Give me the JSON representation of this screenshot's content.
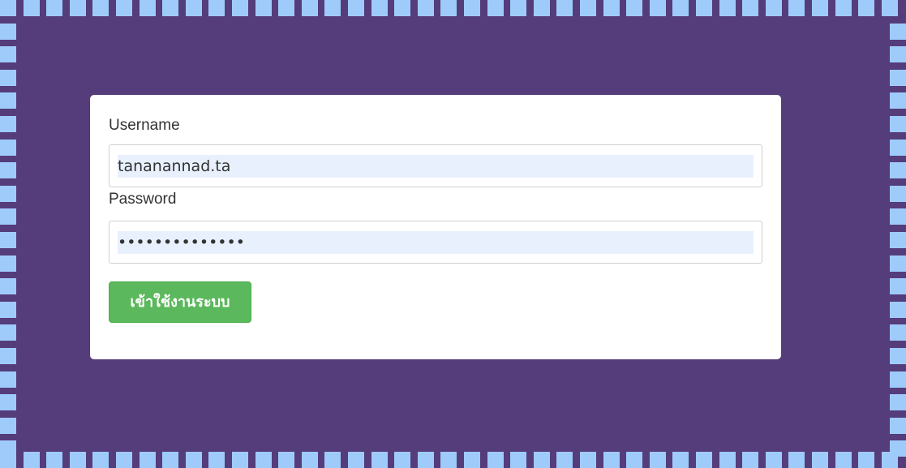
{
  "form": {
    "username_label": "Username",
    "username_value": "tananannad.ta",
    "password_label": "Password",
    "password_value": "••••••••••••••",
    "login_button_label": "เข้าใช้งานระบบ"
  },
  "colors": {
    "background": "#553c7b",
    "border_dots": "#9fcbfb",
    "card": "#ffffff",
    "autofill": "#e8f0fe",
    "button": "#5cb85c",
    "button_text": "#ffffff",
    "label_text": "#333333"
  }
}
